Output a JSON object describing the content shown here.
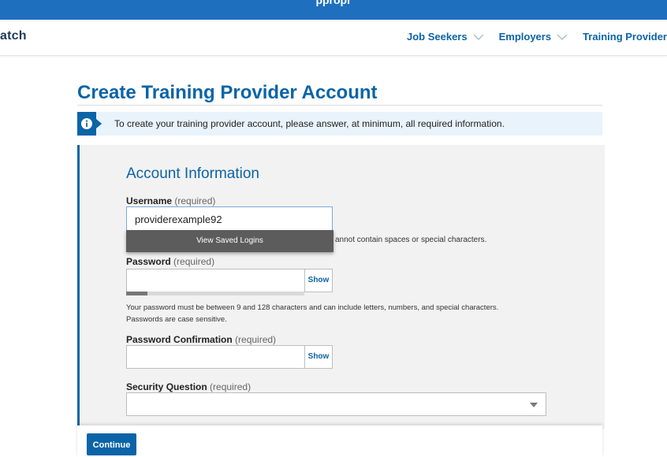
{
  "top_banner": {
    "text": "ppropr"
  },
  "header": {
    "logo_text": "atch",
    "nav": [
      {
        "label": "Job Seekers"
      },
      {
        "label": "Employers"
      },
      {
        "label": "Training Provider"
      }
    ]
  },
  "page": {
    "title": "Create Training Provider Account",
    "alert_text": "To create your training provider account, please answer, at minimum, all required information."
  },
  "form": {
    "section_title": "Account Information",
    "username": {
      "label": "Username",
      "required": "(required)",
      "value": "providerexample92",
      "hint": "annot contain spaces or special characters."
    },
    "autofill": {
      "label": "View Saved Logins"
    },
    "password": {
      "label": "Password",
      "required": "(required)",
      "value": "",
      "show_label": "Show",
      "strength": 0.12,
      "help_line1": "Your password must be between 9 and 128 characters and can include letters, numbers, and special characters.",
      "help_line2": "Passwords are case sensitive."
    },
    "password_confirmation": {
      "label": "Password Confirmation",
      "required": "(required)",
      "value": "",
      "show_label": "Show"
    },
    "security_question": {
      "label": "Security Question",
      "required": "(required)",
      "selected": ""
    },
    "continue_label": "Continue"
  },
  "colors": {
    "brand_blue": "#0b64a7",
    "banner_blue": "#1f6fbf",
    "panel_bg": "#f2f2f2",
    "alert_bg": "#e9f3fb"
  }
}
